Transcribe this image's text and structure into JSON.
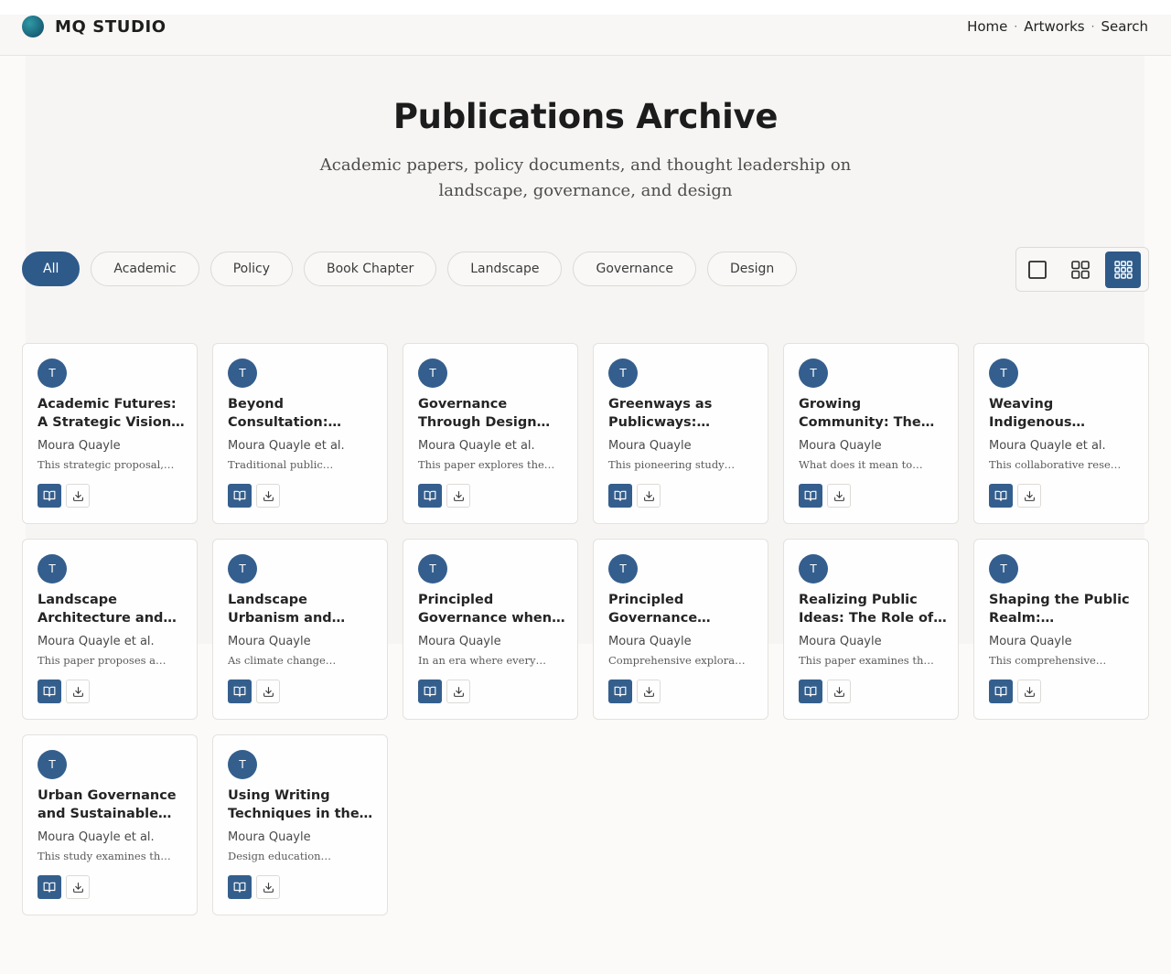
{
  "brand": {
    "name": "MQ STUDIO"
  },
  "nav": {
    "items": [
      "Home",
      "Artworks",
      "Search"
    ],
    "separator": "·"
  },
  "hero": {
    "title": "Publications Archive",
    "subtitle": "Academic papers, policy documents, and thought leadership on landscape, governance, and design"
  },
  "filters": {
    "active": "All",
    "items": [
      "All",
      "Academic",
      "Policy",
      "Book Chapter",
      "Landscape",
      "Governance",
      "Design"
    ]
  },
  "view_toggle": {
    "options": [
      "single-column",
      "two-by-two-grid",
      "three-by-three-grid"
    ],
    "active": "three-by-three-grid"
  },
  "colors": {
    "accent": "#2e5a8a",
    "background": "#fbfaf8"
  },
  "publications": [
    {
      "avatar": "T",
      "title": "Academic Futures: A Strategic Vision…",
      "author": "Moura Quayle",
      "excerpt": "This strategic proposal,…"
    },
    {
      "avatar": "T",
      "title": "Beyond Consultation:…",
      "author": "Moura Quayle et al.",
      "excerpt": "Traditional public…"
    },
    {
      "avatar": "T",
      "title": "Governance Through Design…",
      "author": "Moura Quayle et al.",
      "excerpt": "This paper explores the…"
    },
    {
      "avatar": "T",
      "title": "Greenways as Publicways:…",
      "author": "Moura Quayle",
      "excerpt": "This pioneering study…"
    },
    {
      "avatar": "T",
      "title": "Growing Community: The…",
      "author": "Moura Quayle",
      "excerpt": "What does it mean to…"
    },
    {
      "avatar": "T",
      "title": "Weaving Indigenous Knowledge into…",
      "author": "Moura Quayle et al.",
      "excerpt": "This collaborative resear…"
    },
    {
      "avatar": "T",
      "title": "Landscape Architecture and…",
      "author": "Moura Quayle et al.",
      "excerpt": "This paper proposes a…"
    },
    {
      "avatar": "T",
      "title": "Landscape Urbanism and…",
      "author": "Moura Quayle",
      "excerpt": "As climate change…"
    },
    {
      "avatar": "T",
      "title": "Principled Governance when…",
      "author": "Moura Quayle",
      "excerpt": "In an era where every…"
    },
    {
      "avatar": "T",
      "title": "Principled Governance When…",
      "author": "Moura Quayle",
      "excerpt": "Comprehensive explorati…"
    },
    {
      "avatar": "T",
      "title": "Realizing Public Ideas: The Role of…",
      "author": "Moura Quayle",
      "excerpt": "This paper examines the…"
    },
    {
      "avatar": "T",
      "title": "Shaping the Public Realm: Landscape…",
      "author": "Moura Quayle",
      "excerpt": "This comprehensive…"
    },
    {
      "avatar": "T",
      "title": "Urban Governance and Sustainable…",
      "author": "Moura Quayle et al.",
      "excerpt": "This study examines the…"
    },
    {
      "avatar": "T",
      "title": "Using Writing Techniques in the…",
      "author": "Moura Quayle",
      "excerpt": "Design education…"
    }
  ],
  "card_actions": {
    "read_icon": "book-open-icon",
    "download_icon": "download-icon"
  }
}
